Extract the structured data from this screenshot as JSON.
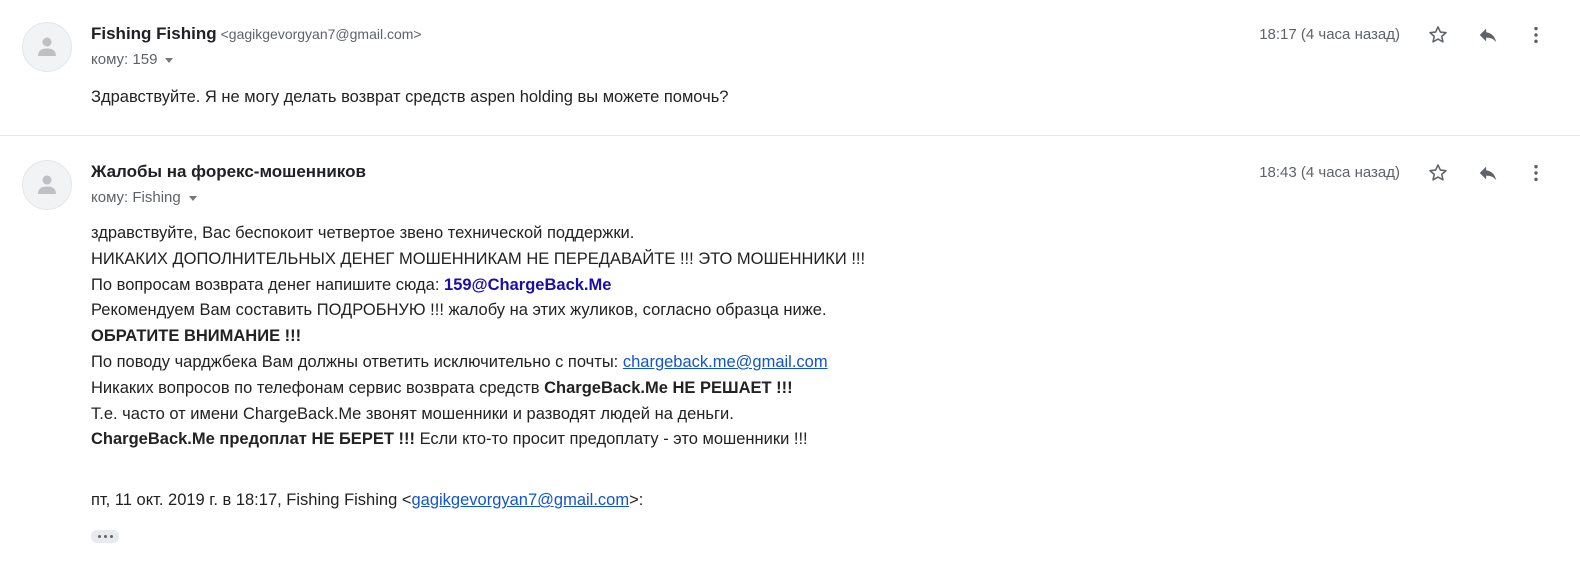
{
  "messages": [
    {
      "sender_name": "Fishing Fishing",
      "sender_email": "<gagikgevorgyan7@gmail.com>",
      "to_label": "кому: 159",
      "time": "18:17 (4 часа назад)",
      "star_icon": "star-outline-icon",
      "reply_icon": "reply-icon",
      "more_icon": "more-vert-icon",
      "avatar_icon": "person-icon",
      "body": "Здравствуйте. Я не могу  делать возврат средств aspen holding вы можете помочь?"
    },
    {
      "sender_name": "Жалобы на форекс-мошенников",
      "sender_email": "",
      "to_label": "кому: Fishing",
      "time": "18:43 (4 часа назад)",
      "star_icon": "star-outline-icon",
      "reply_icon": "reply-icon",
      "more_icon": "more-vert-icon",
      "avatar_icon": "person-icon",
      "body_lines": {
        "l1": "здравствуйте, Вас беспокоит четвертое звено технической поддержки.",
        "l2": "НИКАКИХ ДОПОЛНИТЕЛЬНЫХ ДЕНЕГ МОШЕННИКАМ НЕ ПЕРЕДАВАЙТЕ !!! ЭТО МОШЕННИКИ !!!",
        "l3_text": "По вопросам возврата денег напишите сюда: ",
        "l3_email": "159@ChargeBack.Me",
        "l4": "Рекомендуем Вам составить ПОДРОБНУЮ !!! жалобу на этих жуликов, согласно образца ниже.",
        "l5": "ОБРАТИТЕ ВНИМАНИЕ !!!",
        "l6_text": "По поводу чарджбека Вам должны ответить исключительно с почты: ",
        "l6_link": "chargeback.me@gmail.com",
        "l7_text": "Никаких вопросов по телефонам сервис возврата средств ",
        "l7_bold": "ChargeBack.Me НЕ РЕШАЕТ !!!",
        "l8": "Т.е. часто от имени ChargeBack.Me звонят мошенники и разводят людей на деньги.",
        "l9_bold": "ChargeBack.Me предоплат НЕ БЕРЕТ !!!",
        "l9_text": " Если кто-то просит предоплату - это мошенники !!!"
      },
      "quote": {
        "prefix": "пт, 11 окт. 2019 г. в 18:17, Fishing Fishing <",
        "link": "gagikgevorgyan7@gmail.com",
        "suffix": ">:"
      },
      "show_trimmed_icon": "ellipsis-icon"
    }
  ]
}
